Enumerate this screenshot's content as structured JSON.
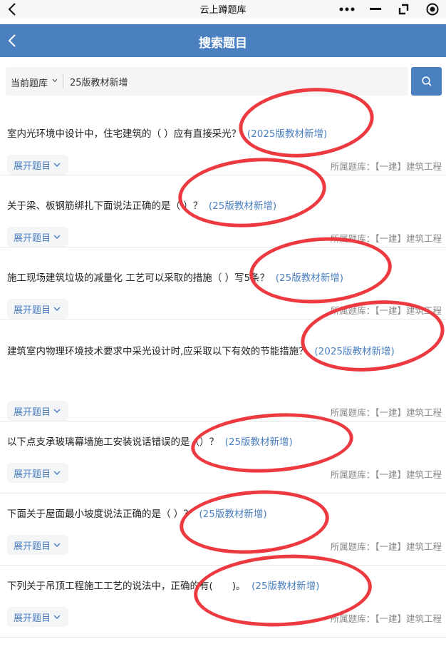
{
  "app_title": "云上蹲题库",
  "header": {
    "title": "搜索题目"
  },
  "search": {
    "scope_label": "当前题库",
    "query": "25版教材新增"
  },
  "bank_label": "所属题库：",
  "expand_label": "展开题目",
  "questions": [
    {
      "text": "室内光环境中设计中，住宅建筑的（ ）应有直接采光？",
      "tag": "(2025版教材新增)",
      "bank": "【一建】建筑工程"
    },
    {
      "text": "关于梁、板钢筋绑扎下面说法正确的是（ ）？",
      "tag": "(25版教材新增)",
      "bank": "【一建】建筑工程"
    },
    {
      "text": "施工现场建筑垃圾的减量化 工艺可以采取的措施（ ）写5条？",
      "tag": "(25版教材新增)",
      "bank": "【一建】建筑工程"
    },
    {
      "text": "建筑室内物理环境技术要求中采光设计时,应采取以下有效的节能措施？",
      "tag": "(2025版教材新增)",
      "bank": "【一建】建筑工程"
    },
    {
      "text": "以下点支承玻璃幕墙施工安装说话错误的是（）？",
      "tag": "(25版教材新增)",
      "bank": "【一建】建筑工程"
    },
    {
      "text": "下面关于屋面最小坡度说法正确的是（ ）？",
      "tag": "(25版教材新增)",
      "bank": "【一建】建筑工程"
    },
    {
      "text": "下列关于吊顶工程施工工艺的说法中，正确的有(　　)。",
      "tag": "(25版教材新增)",
      "bank": "【一建】建筑工程"
    }
  ]
}
